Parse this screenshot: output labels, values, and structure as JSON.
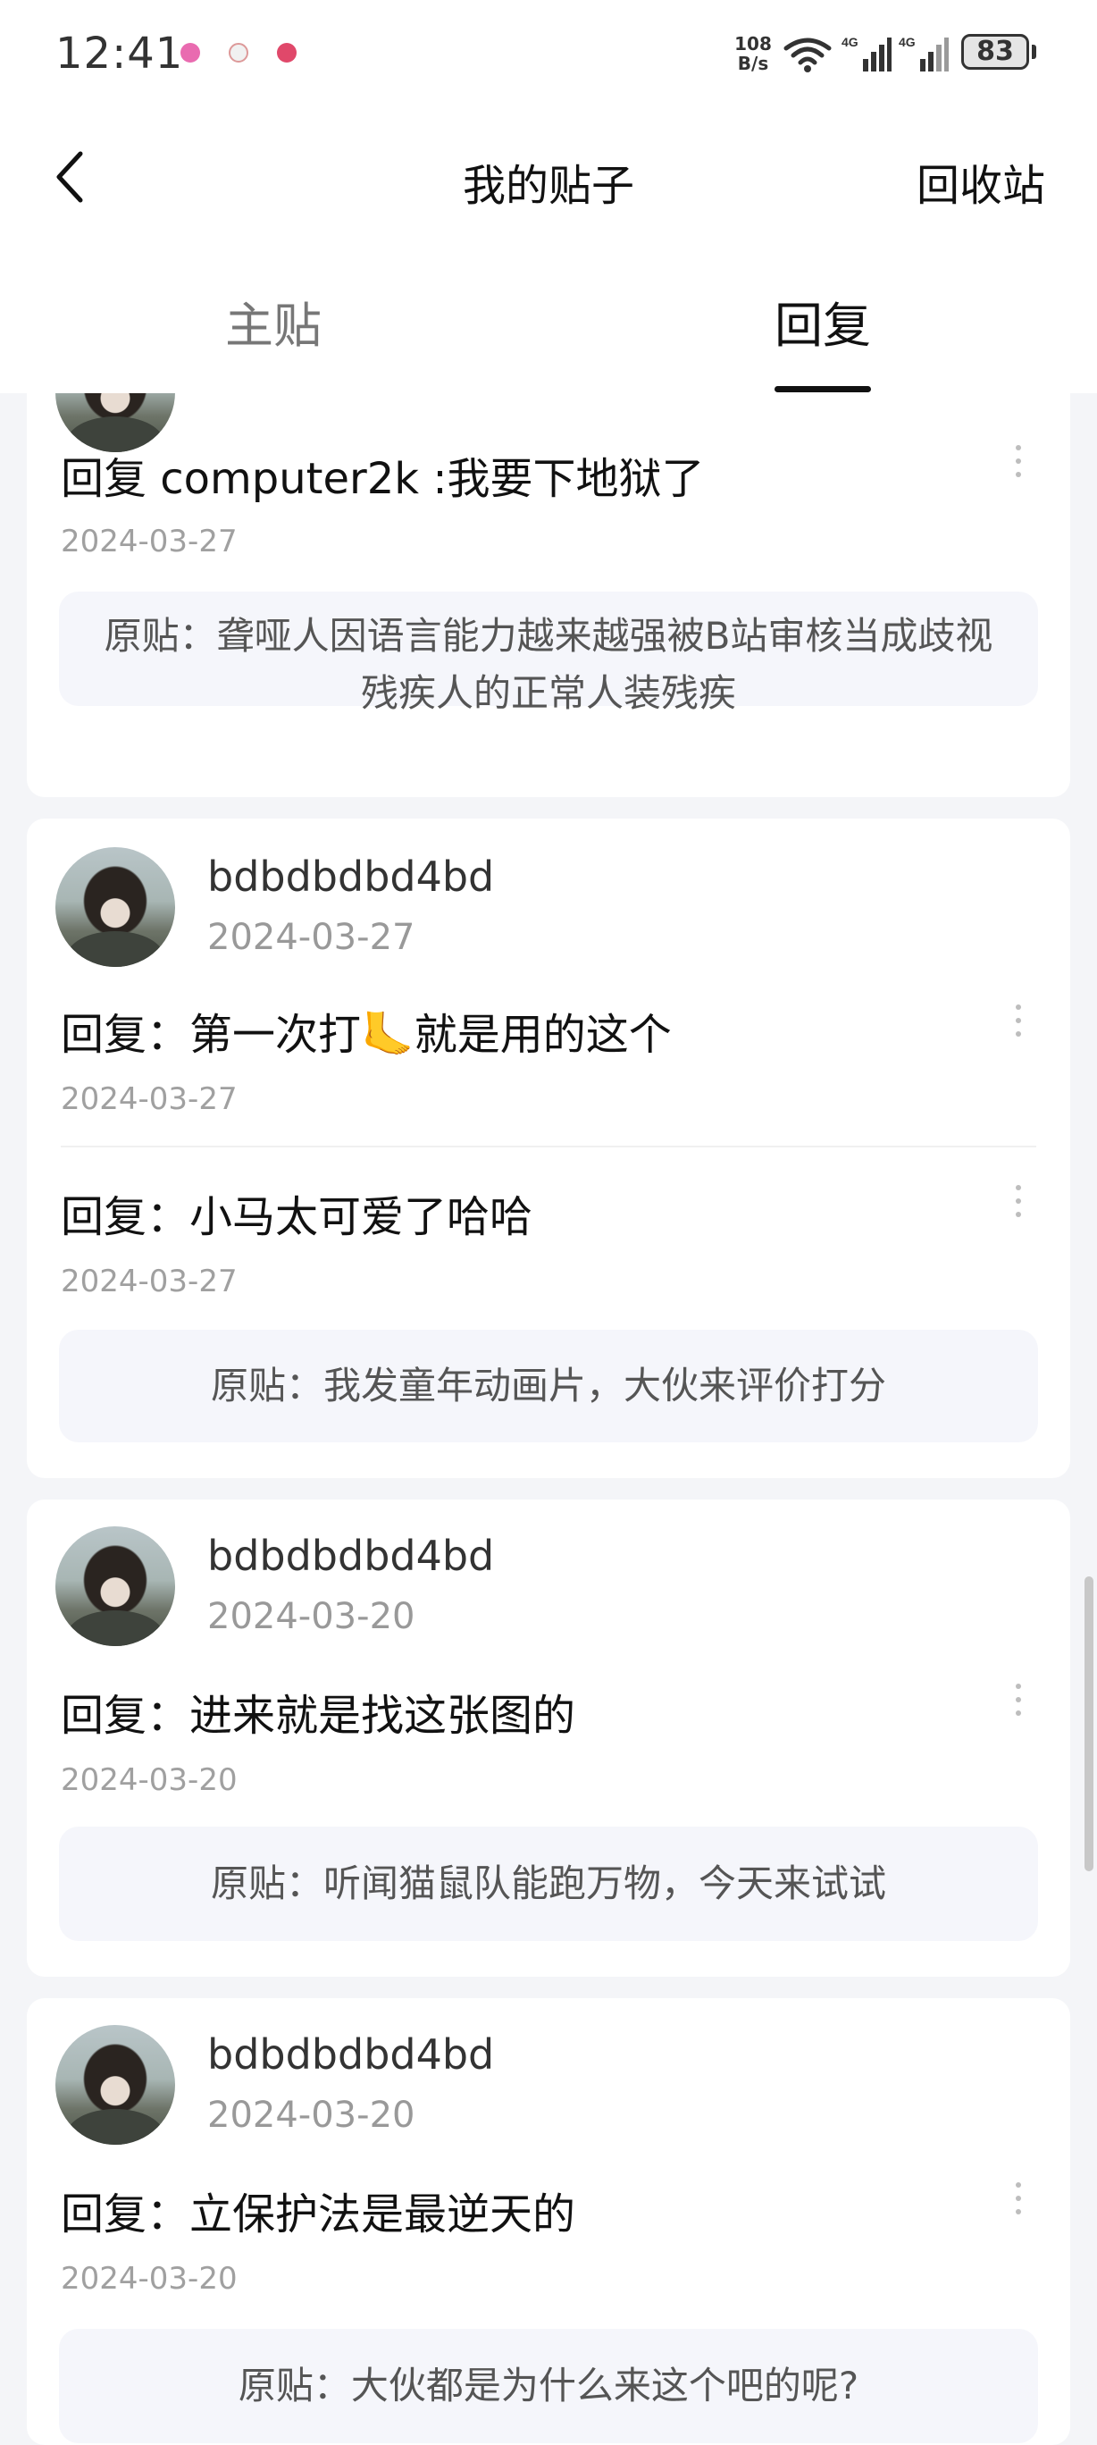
{
  "status_bar": {
    "time": "12:41",
    "net_speed_value": "108",
    "net_speed_unit": "B/s",
    "network_1": "4G",
    "network_2": "4G",
    "battery": "83"
  },
  "nav": {
    "title": "我的贴子",
    "action": "回收站"
  },
  "tabs": [
    {
      "label": "主贴",
      "active": false
    },
    {
      "label": "回复",
      "active": true
    }
  ],
  "cards": [
    {
      "replies": [
        {
          "text": "回复 computer2k :我要下地狱了",
          "date": "2024-03-27"
        }
      ],
      "original": "原贴：聋哑人因语言能力越来越强被B站审核当成歧视残疾人的正常人装残疾"
    },
    {
      "username": "bdbdbdbd4bd",
      "date": "2024-03-27",
      "replies": [
        {
          "text": "回复：第一次打🦶就是用的这个",
          "date": "2024-03-27"
        },
        {
          "text": "回复：小马太可爱了哈哈",
          "date": "2024-03-27"
        }
      ],
      "original": "原贴：我发童年动画片，大伙来评价打分"
    },
    {
      "username": "bdbdbdbd4bd",
      "date": "2024-03-20",
      "replies": [
        {
          "text": "回复：进来就是找这张图的",
          "date": "2024-03-20"
        }
      ],
      "original": "原贴：听闻猫鼠队能跑万物，今天来试试"
    },
    {
      "username": "bdbdbdbd4bd",
      "date": "2024-03-20",
      "replies": [
        {
          "text": "回复：立保护法是最逆天的",
          "date": "2024-03-20"
        }
      ],
      "original": "原贴：大伙都是为什么来这个吧的呢?"
    }
  ]
}
